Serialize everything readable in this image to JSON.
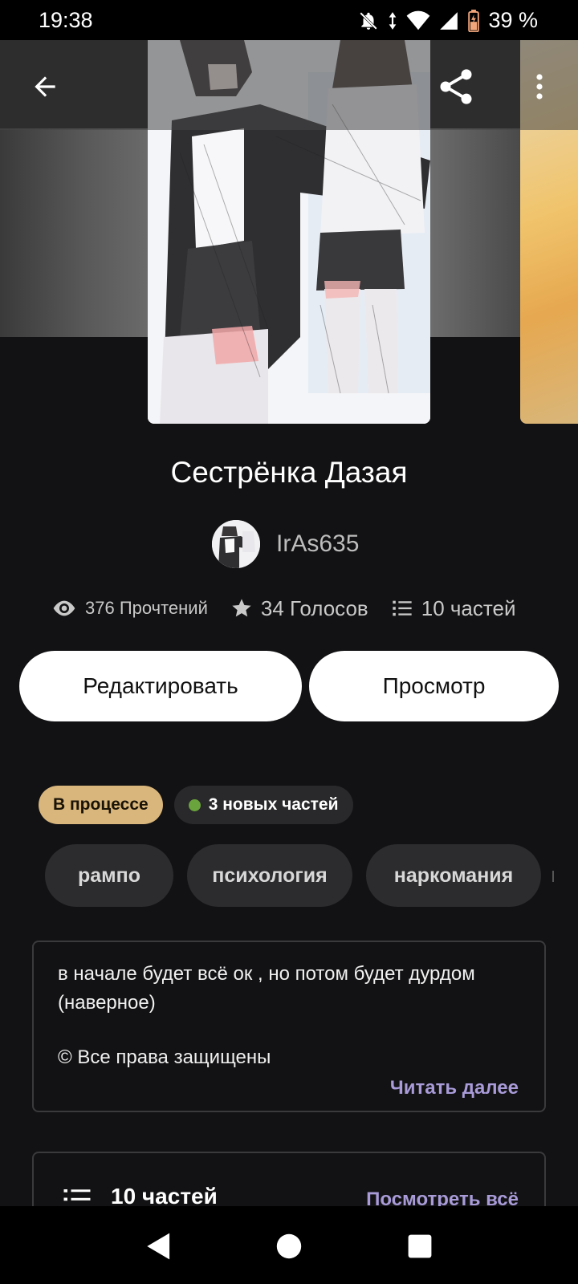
{
  "status_bar": {
    "time": "19:38",
    "battery_percent": "39 %",
    "icons": [
      "bell-off-icon",
      "data-arrows-icon",
      "wifi-icon",
      "signal-icon",
      "battery-icon"
    ]
  },
  "toolbar": {
    "back_icon": "arrow-left-icon",
    "share_icon": "share-icon",
    "more_icon": "more-vertical-icon"
  },
  "story": {
    "title": "Сестрёнка Дазая",
    "author": "IrAs635",
    "stats": {
      "reads": "376 Прочтений",
      "votes": "34 Голосов",
      "parts": "10 частей"
    }
  },
  "actions": {
    "edit_label": "Редактировать",
    "view_label": "Просмотр"
  },
  "badges": {
    "status": "В процессе",
    "new_parts": "3 новых частей"
  },
  "tags": [
    "рампо",
    "психология",
    "наркомания"
  ],
  "description": {
    "text": "в начале будет всё ок , но потом будет дурдом (наверное)",
    "copyright": "© Все права защищены",
    "read_more": "Читать далее"
  },
  "parts_section": {
    "title": "10 частей",
    "see_all": "Посмотреть всё"
  },
  "colors": {
    "background": "#121113",
    "accent": "#a89bd8",
    "status_badge": "#d8b67c",
    "new_dot": "#6aa43c"
  }
}
